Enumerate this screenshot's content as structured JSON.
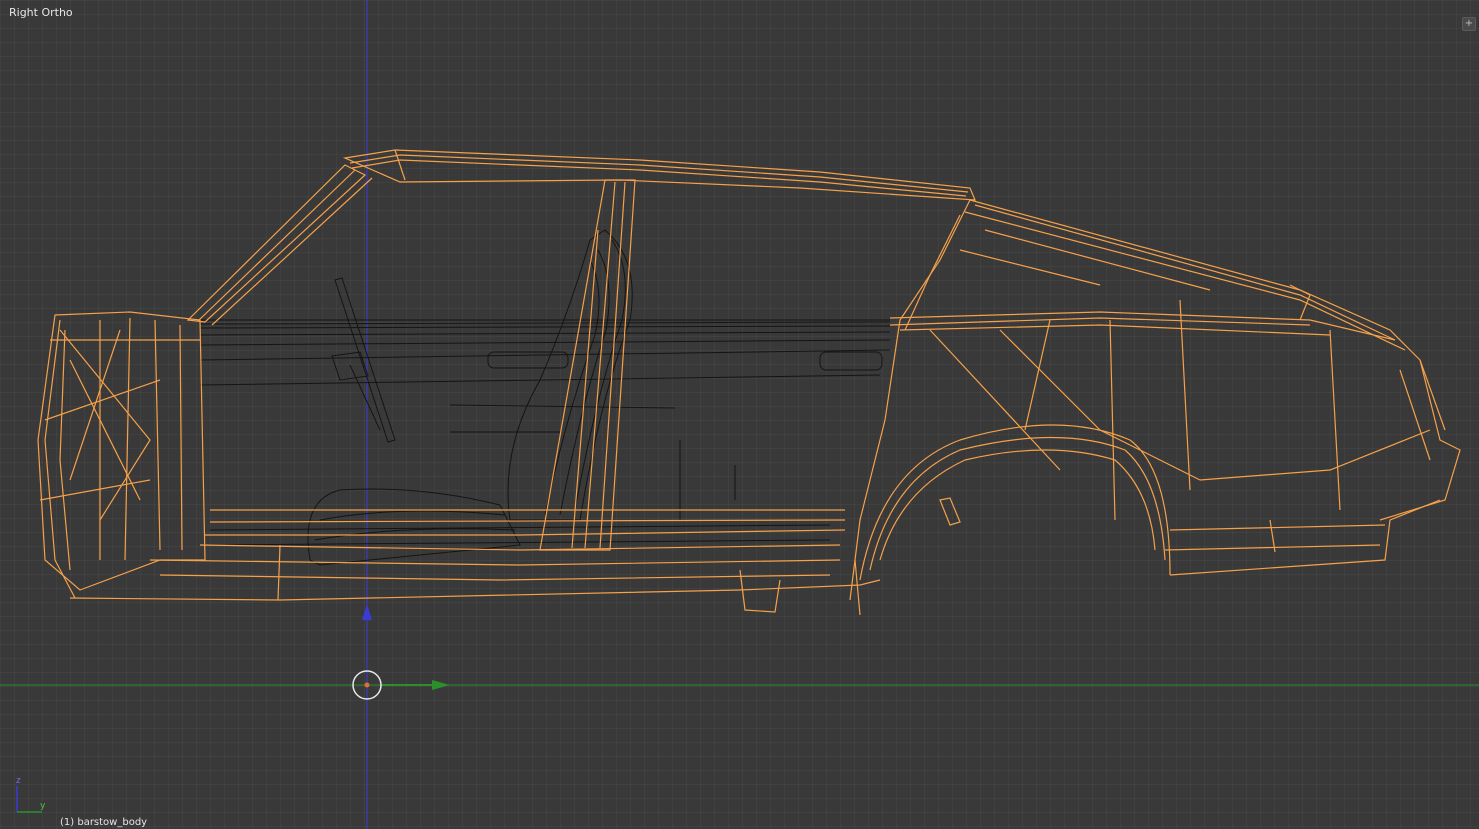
{
  "viewport": {
    "view_name": "Right Ortho",
    "object_name": "(1) barstow_body",
    "corner_widget_icon": "plus-icon",
    "corner_widget_glyph": "+"
  },
  "colors": {
    "background": "#393939",
    "selected_wire": "#f5a14a",
    "unselected_wire": "#111111",
    "axis_x": "#2b8f2b",
    "axis_z": "#3b3bd6",
    "cursor_ring": "#e8e8e8",
    "cursor_dot": "#e07030"
  },
  "axis_gizmo": {
    "x_label": "y",
    "z_label": "z"
  }
}
